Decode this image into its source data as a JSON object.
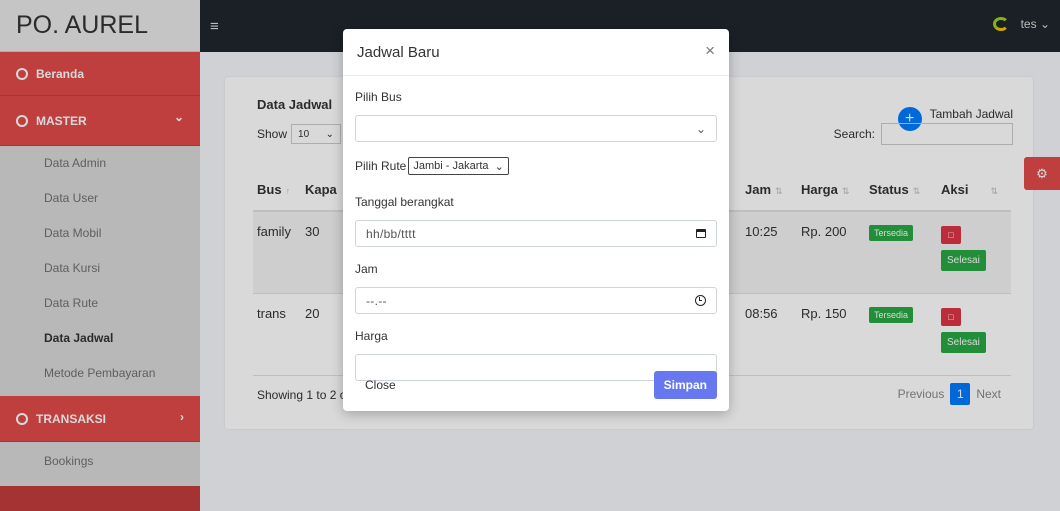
{
  "brand": "PO. AUREL",
  "sidebar": {
    "beranda": "Beranda",
    "master": "MASTER",
    "master_items": [
      "Data Admin",
      "Data User",
      "Data Mobil",
      "Data Kursi",
      "Data Rute",
      "Data Jadwal",
      "Metode Pembayaran"
    ],
    "transaksi": "TRANSAKSI",
    "transaksi_items": [
      "Bookings"
    ]
  },
  "topbar": {
    "user": "tes"
  },
  "card": {
    "title": "Data Jadwal",
    "add_label": "Tambah Jadwal",
    "show_label": "Show",
    "show_value": "10",
    "search_label": "Search:",
    "columns": [
      "Bus",
      "Kapa",
      "Jam",
      "Harga",
      "Status",
      "Aksi"
    ],
    "rows": [
      {
        "bus": "family",
        "kap": "30",
        "jam": "10:25",
        "harga": "Rp. 200",
        "status": "Tersedia",
        "done": "Selesai"
      },
      {
        "bus": "trans",
        "kap": "20",
        "jam": "08:56",
        "harga": "Rp. 150",
        "status": "Tersedia",
        "done": "Selesai"
      }
    ],
    "showing": "Showing 1 to 2 of",
    "prev": "Previous",
    "page": "1",
    "next": "Next"
  },
  "modal": {
    "title": "Jadwal Baru",
    "bus_label": "Pilih Bus",
    "bus_value": "",
    "rute_label": "Pilih Rute",
    "rute_value": "Jambi - Jakarta",
    "tanggal_label": "Tanggal berangkat",
    "tanggal_placeholder": "hh/bb/tttt",
    "jam_label": "Jam",
    "jam_placeholder": "--.--",
    "harga_label": "Harga",
    "harga_value": "",
    "close_label": "Close",
    "save_label": "Simpan"
  },
  "colors": {
    "accent_red": "#e14a4a",
    "primary_blue": "#007bff",
    "save_purple": "#6777ef",
    "success_green": "#28a745"
  }
}
